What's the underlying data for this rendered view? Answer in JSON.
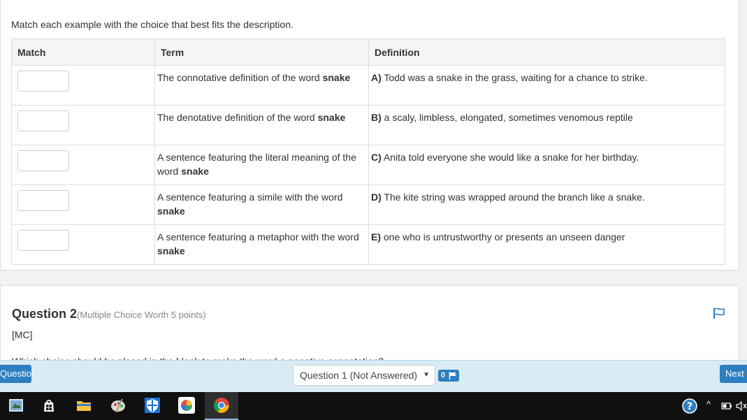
{
  "question1": {
    "instruction": "Match each example with the choice that best fits the description.",
    "headers": {
      "match": "Match",
      "term": "Term",
      "definition": "Definition"
    },
    "rows": [
      {
        "term_pre": "The connotative definition of the word ",
        "term_bold": "snake",
        "def_letter": "A)",
        "def_text": " Todd was a snake in the grass, waiting for a chance to strike."
      },
      {
        "term_pre": "The denotative definition of the word ",
        "term_bold": "snake",
        "def_letter": "B)",
        "def_text": " a scaly, limbless, elongated, sometimes venomous reptile"
      },
      {
        "term_pre": "A sentence featuring the literal meaning of the word ",
        "term_bold": "snake",
        "def_letter": "C)",
        "def_text": " Anita told everyone she would like a snake for her birthday."
      },
      {
        "term_pre": "A sentence featuring a simile with the word ",
        "term_bold": "snake",
        "def_letter": "D)",
        "def_text": " The kite string was wrapped around the branch like a snake."
      },
      {
        "term_pre": "A sentence featuring a metaphor with the word ",
        "term_bold": "snake",
        "def_letter": "E)",
        "def_text": " one who is untrustworthy or presents an unseen danger"
      }
    ]
  },
  "question2": {
    "title": "Question 2",
    "meta": "(Multiple Choice Worth 5 points)",
    "type_tag": "[MC]",
    "prompt_partial": "Which choice should be placed in the blank to make the word a negative connotation?"
  },
  "nav": {
    "prev_label": "Question",
    "select_value": "Question 1 (Not Answered)",
    "flag_count": "0",
    "next_label": "Next"
  },
  "colors": {
    "accent": "#2d7fc0",
    "navbar": "#d9ecf6",
    "taskbar": "#101010"
  }
}
